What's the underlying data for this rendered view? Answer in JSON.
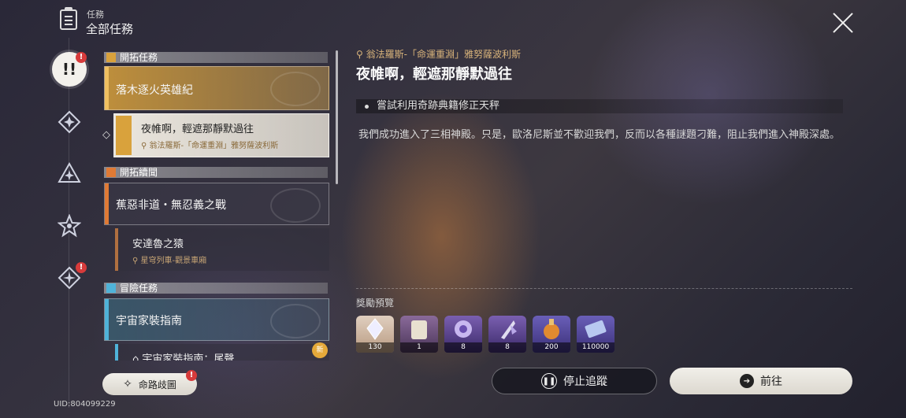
{
  "header": {
    "small_label": "任務",
    "title": "全部任務"
  },
  "rail": {
    "badge_1": "!",
    "badge_2": "!"
  },
  "quest_list": {
    "sections": [
      {
        "label": "開拓任務",
        "color": "#d9a23c"
      },
      {
        "label": "開拓續聞",
        "color": "#e07a35"
      },
      {
        "label": "冒險任務",
        "color": "#4fb3d9"
      }
    ],
    "main_1": {
      "title": "落木逐火英雄紀"
    },
    "selected_sub": {
      "title": "夜帷啊，輕遮那靜默過往",
      "location": "翁法羅斯-「命運重淵」雅努薩波利斯"
    },
    "main_2": {
      "title": "蕉惡非道・無忍義之戰"
    },
    "sub_2": {
      "title": "安達魯之猿",
      "location": "星穹列車-觀景車廂"
    },
    "main_3": {
      "title": "宇宙家裝指南"
    },
    "sub_3": {
      "title": "宇宙家裝指南：尾聲",
      "new_badge": "新"
    }
  },
  "detail": {
    "location": "翁法羅斯-「命運重淵」雅努薩波利斯",
    "title": "夜帷啊，輕遮那靜默過往",
    "objective": "嘗試利用奇跡典籍修正天秤",
    "description": "我們成功進入了三相神殿。只是，歐洛尼斯並不歡迎我們，反而以各種謎題刁難，阻止我們進入神殿深處。",
    "reward_label": "獎勵預覽",
    "rewards": [
      {
        "count": "130",
        "icon": "stellar-jade-icon",
        "color": "#c9b5a3"
      },
      {
        "count": "1",
        "icon": "scroll-icon",
        "color": "#6a4c7a"
      },
      {
        "count": "8",
        "icon": "purple-material-icon",
        "color": "#5a3f8c"
      },
      {
        "count": "8",
        "icon": "purple-crystal-icon",
        "color": "#5a3f8c"
      },
      {
        "count": "200",
        "icon": "exp-potion-icon",
        "color": "#4d4590"
      },
      {
        "count": "110000",
        "icon": "credit-icon",
        "color": "#4d4590"
      }
    ]
  },
  "buttons": {
    "stop_tracking": "停止追蹤",
    "go": "前往",
    "path": "命路歧圖",
    "path_badge": "!"
  },
  "uid": "UID:804099229"
}
